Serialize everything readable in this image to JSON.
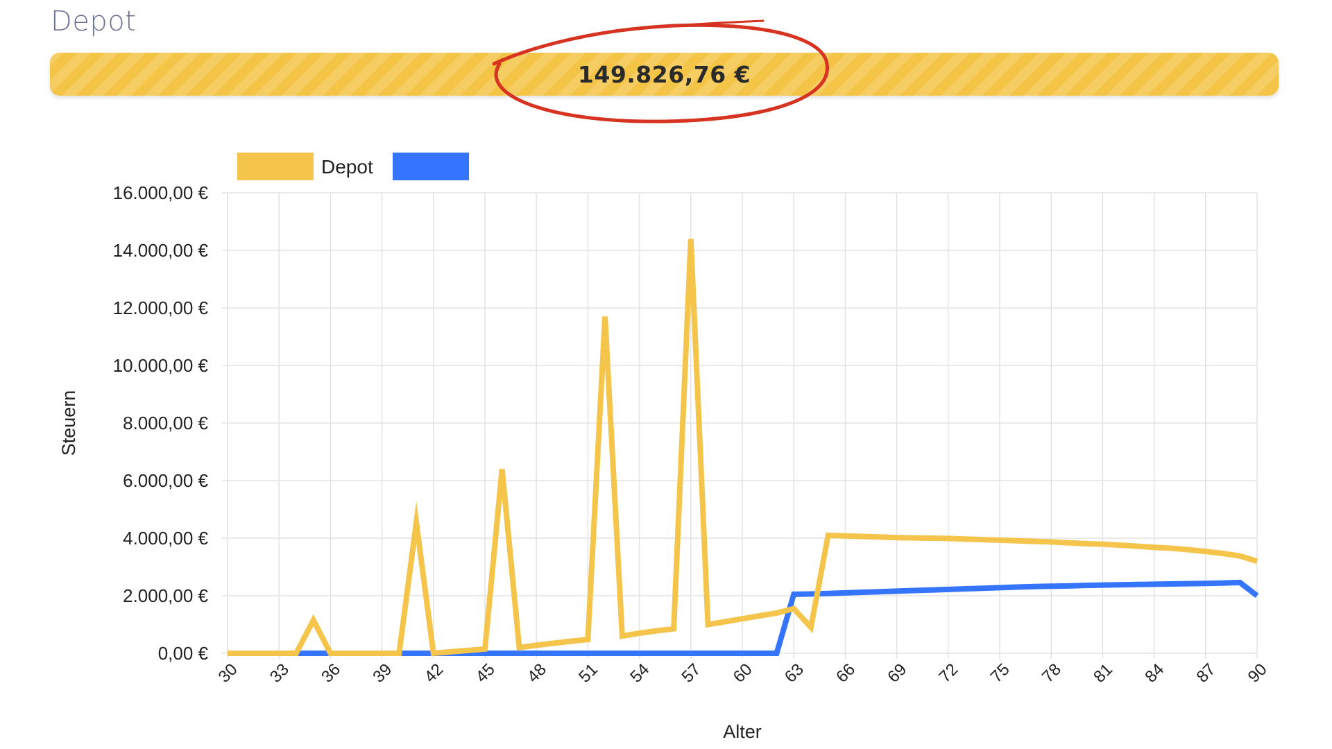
{
  "header": {
    "title": "Depot",
    "total_value": "149.826,76 €"
  },
  "colors": {
    "accent_yellow": "#f3c445",
    "series_yellow": "#f4c54a",
    "series_blue": "#3575fd",
    "annotation_red": "#d63320",
    "grid": "#e3e3e3"
  },
  "chart_data": {
    "type": "line",
    "xlabel": "Alter",
    "ylabel": "Steuern",
    "xlim": [
      30,
      90
    ],
    "ylim": [
      0,
      16000
    ],
    "x_ticks": [
      "30",
      "33",
      "36",
      "39",
      "42",
      "45",
      "48",
      "51",
      "54",
      "57",
      "60",
      "63",
      "66",
      "69",
      "72",
      "75",
      "78",
      "81",
      "84",
      "87",
      "90"
    ],
    "y_ticks": [
      "0,00 €",
      "2.000,00 €",
      "4.000,00 €",
      "6.000,00 €",
      "8.000,00 €",
      "10.000,00 €",
      "12.000,00 €",
      "14.000,00 €",
      "16.000,00 €"
    ],
    "grid": true,
    "legend_position": "top-left",
    "x": [
      30,
      31,
      32,
      33,
      34,
      35,
      36,
      37,
      38,
      39,
      40,
      41,
      42,
      43,
      44,
      45,
      46,
      47,
      48,
      49,
      50,
      51,
      52,
      53,
      54,
      55,
      56,
      57,
      58,
      59,
      60,
      61,
      62,
      63,
      64,
      65,
      66,
      67,
      68,
      69,
      70,
      71,
      72,
      73,
      74,
      75,
      76,
      77,
      78,
      79,
      80,
      81,
      82,
      83,
      84,
      85,
      86,
      87,
      88,
      89,
      90
    ],
    "series": [
      {
        "name": "Depot",
        "color": "#f4c54a",
        "values": [
          0,
          0,
          0,
          0,
          0,
          1150,
          0,
          0,
          0,
          0,
          0,
          4550,
          0,
          50,
          100,
          150,
          6400,
          200,
          280,
          350,
          420,
          480,
          11700,
          600,
          700,
          780,
          850,
          14400,
          1000,
          1100,
          1200,
          1300,
          1400,
          1550,
          900,
          4100,
          4080,
          4060,
          4040,
          4020,
          4010,
          4000,
          3990,
          3970,
          3950,
          3930,
          3910,
          3890,
          3870,
          3840,
          3810,
          3790,
          3760,
          3720,
          3680,
          3650,
          3600,
          3540,
          3470,
          3380,
          3200
        ]
      },
      {
        "name": "",
        "color": "#3575fd",
        "values": [
          0,
          0,
          0,
          0,
          0,
          0,
          0,
          0,
          0,
          0,
          0,
          0,
          0,
          0,
          0,
          0,
          0,
          0,
          0,
          0,
          0,
          0,
          0,
          0,
          0,
          0,
          0,
          0,
          0,
          0,
          0,
          0,
          0,
          2050,
          2060,
          2080,
          2100,
          2120,
          2140,
          2160,
          2180,
          2200,
          2220,
          2240,
          2260,
          2280,
          2300,
          2320,
          2330,
          2340,
          2360,
          2370,
          2380,
          2390,
          2400,
          2410,
          2420,
          2430,
          2440,
          2460,
          2000
        ]
      }
    ]
  }
}
